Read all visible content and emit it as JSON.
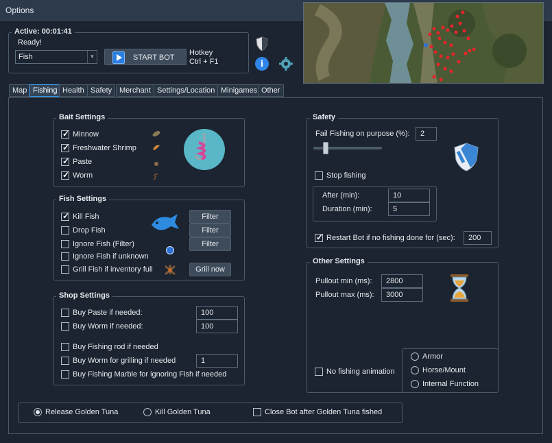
{
  "window": {
    "title": "Options"
  },
  "status": {
    "active_label": "Active: 00:01:41",
    "ready": "Ready!",
    "mode_value": "Fish",
    "start_label": "START BOT",
    "hotkey_label": "Hotkey",
    "hotkey_value": "Ctrl + F1"
  },
  "tabs": [
    {
      "label": "Map"
    },
    {
      "label": "Fishing"
    },
    {
      "label": "Health"
    },
    {
      "label": "Safety"
    },
    {
      "label": "Merchant"
    },
    {
      "label": "Settings/Location"
    },
    {
      "label": "Minigames"
    },
    {
      "label": "Other"
    }
  ],
  "bait": {
    "title": "Bait Settings",
    "items": [
      {
        "label": "Minnow",
        "checked": true
      },
      {
        "label": "Freshwater Shrimp",
        "checked": true
      },
      {
        "label": "Paste",
        "checked": true
      },
      {
        "label": "Worm",
        "checked": true
      }
    ]
  },
  "fish": {
    "title": "Fish Settings",
    "items": [
      {
        "label": "Kill Fish",
        "checked": true
      },
      {
        "label": "Drop Fish",
        "checked": false
      },
      {
        "label": "Ignore Fish (Filter)",
        "checked": false
      },
      {
        "label": "Ignore Fish if unknown",
        "checked": false
      },
      {
        "label": "Grill Fish if inventory full",
        "checked": false
      }
    ],
    "filter_label": "Filter",
    "grill_label": "Grill now"
  },
  "shop": {
    "title": "Shop Settings",
    "items": [
      {
        "label": "Buy Paste if needed:",
        "checked": false,
        "value": "100"
      },
      {
        "label": "Buy Worm if needed:",
        "checked": false,
        "value": "100"
      },
      {
        "label": "Buy Fishing rod if needed",
        "checked": false
      },
      {
        "label": "Buy Worm for grilling if needed",
        "checked": false,
        "value": "1"
      },
      {
        "label": "Buy Fishing Marble for ignoring Fish if needed",
        "checked": false
      }
    ]
  },
  "safety": {
    "title": "Safety",
    "fail_label": "Fail Fishing on purpose (%):",
    "fail_value": "2",
    "fail_level": 0.15,
    "stop_label": "Stop fishing",
    "stop_checked": false,
    "after_label": "After (min):",
    "after_value": "10",
    "duration_label": "Duration (min):",
    "duration_value": "5",
    "restart_label": "Restart Bot if no fishing done for (sec):",
    "restart_checked": true,
    "restart_value": "200"
  },
  "other": {
    "title": "Other Settings",
    "pullout_min_label": "Pullout min (ms):",
    "pullout_min_value": "2800",
    "pullout_max_label": "Pullout max (ms):",
    "pullout_max_value": "3000",
    "no_anim_label": "No fishing animation",
    "no_anim_checked": false,
    "options": [
      {
        "label": "Armor",
        "selected": false
      },
      {
        "label": "Horse/Mount",
        "selected": false
      },
      {
        "label": "Internal Function",
        "selected": false
      }
    ]
  },
  "tuna": {
    "release_label": "Release Golden Tuna",
    "release_selected": true,
    "kill_label": "Kill Golden Tuna",
    "kill_selected": false,
    "close_label": "Close Bot after Golden Tuna fished",
    "close_checked": false
  },
  "colors": {
    "accent": "#3ea6ff",
    "background": "#1b2430",
    "title_bar": "#2c3a4b"
  }
}
